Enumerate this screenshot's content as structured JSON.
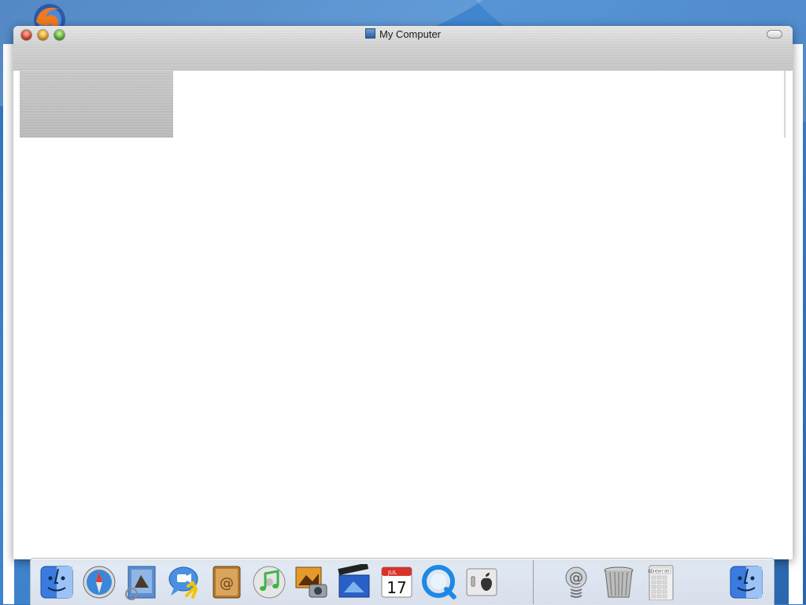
{
  "window": {
    "title": "My Computer"
  },
  "desktop": {
    "icons": [
      {
        "name": "firefox-icon"
      }
    ]
  },
  "dock": {
    "apps": [
      {
        "name": "finder-icon"
      },
      {
        "name": "safari-icon"
      },
      {
        "name": "mail-icon"
      },
      {
        "name": "ichat-icon"
      },
      {
        "name": "address-book-icon"
      },
      {
        "name": "itunes-icon"
      },
      {
        "name": "iphoto-icon"
      },
      {
        "name": "imovie-icon"
      },
      {
        "name": "ical-icon"
      },
      {
        "name": "quicktime-icon"
      },
      {
        "name": "system-preferences-icon"
      }
    ],
    "right_items": [
      {
        "name": "mail-spring-icon"
      },
      {
        "name": "trash-icon"
      },
      {
        "name": "calculator-icon"
      },
      {
        "name": "finder-icon"
      }
    ],
    "ical_month": "JUL",
    "ical_day": "17",
    "calculator_display": "1234567.89",
    "colors": {
      "finder_blue": "#2f6fd6",
      "safari_blue": "#3a86d9",
      "itunes_green": "#3bb54a",
      "quicktime_blue": "#1e88e5"
    }
  }
}
